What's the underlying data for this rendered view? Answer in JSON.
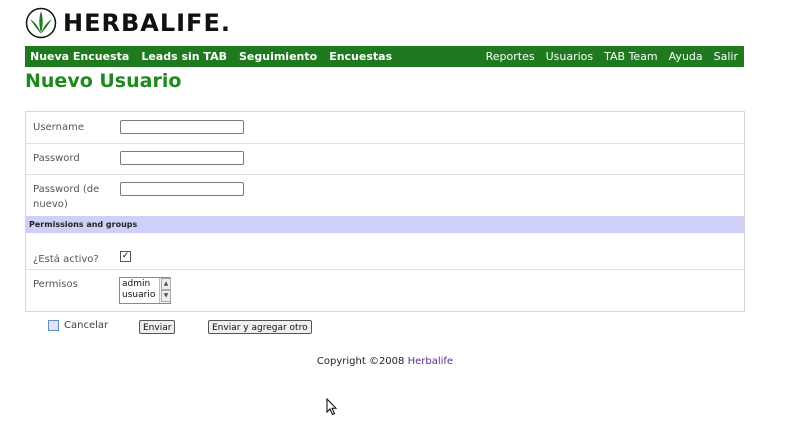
{
  "brand": {
    "name": "HERBALIFE."
  },
  "nav": {
    "left": [
      "Nueva Encuesta",
      "Leads sin TAB",
      "Seguimiento",
      "Encuestas"
    ],
    "right": [
      "Reportes",
      "Usuarios",
      "TAB Team",
      "Ayuda",
      "Salir"
    ]
  },
  "page": {
    "title": "Nuevo Usuario"
  },
  "form": {
    "username_label": "Username",
    "password_label": "Password",
    "password2_label": "Password (de nuevo)",
    "section_title": "Permissions and groups",
    "active_label": "¿Está activo?",
    "active_checked": true,
    "permissions_label": "Permisos",
    "permissions_options": [
      "admin",
      "usuario"
    ]
  },
  "actions": {
    "cancel": "Cancelar",
    "send": "Enviar",
    "send_add": "Enviar y agregar otro"
  },
  "footer": {
    "copyright": "Copyright ©2008",
    "brand_link": "Herbalife"
  },
  "colors": {
    "nav_bg": "#1f7a1f",
    "title": "#1d8a1d",
    "section_bg": "#cfd0f8",
    "link": "#5b2d8a"
  }
}
